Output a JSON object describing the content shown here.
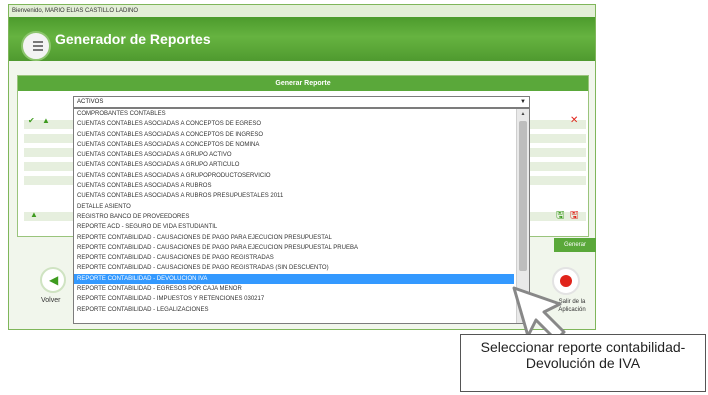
{
  "welcome_text": "Bienvenido, MARIO ELIAS CASTILLO LADINO",
  "header": {
    "title": "Generador de Reportes"
  },
  "panel": {
    "title": "Generar Reporte"
  },
  "select": {
    "selected_value": "ACTIVOS",
    "options": [
      "COMPROBANTES CONTABLES",
      "CUENTAS CONTABLES ASOCIADAS A CONCEPTOS DE EGRESO",
      "CUENTAS CONTABLES ASOCIADAS A CONCEPTOS DE INGRESO",
      "CUENTAS CONTABLES ASOCIADAS A CONCEPTOS DE NOMINA",
      "CUENTAS CONTABLES ASOCIADAS A GRUPO ACTIVO",
      "CUENTAS CONTABLES ASOCIADAS A GRUPO ARTICULO",
      "CUENTAS CONTABLES ASOCIADAS A GRUPOPRODUCTOSERVICIO",
      "CUENTAS CONTABLES ASOCIADAS A RUBROS",
      "CUENTAS CONTABLES ASOCIADAS A RUBROS PRESUPUESTALES 2011",
      "DETALLE ASIENTO",
      "REGISTRO BANCO DE PROVEEDORES",
      "REPORTE ACD - SEGURO DE VIDA ESTUDIANTIL",
      "REPORTE CONTABILIDAD - CAUSACIONES DE PAGO PARA EJECUCION PRESUPUESTAL",
      "REPORTE CONTABILIDAD - CAUSACIONES DE PAGO PARA EJECUCION PRESUPUESTAL PRUEBA",
      "REPORTE CONTABILIDAD - CAUSACIONES DE PAGO REGISTRADAS",
      "REPORTE CONTABILIDAD - CAUSACIONES DE PAGO REGISTRADAS (SIN DESCUENTO)",
      "REPORTE CONTABILIDAD - DEVOLUCION IVA",
      "REPORTE CONTABILIDAD - EGRESOS POR CAJA MENOR",
      "REPORTE CONTABILIDAD - IMPUESTOS Y RETENCIONES 030217",
      "REPORTE CONTABILIDAD - LEGALIZACIONES"
    ],
    "highlighted_option": "REPORTE CONTABILIDAD - DEVOLUCION IVA"
  },
  "buttons": {
    "generar": "Generar",
    "volver": "Volver",
    "salir_line1": "Salir de la",
    "salir_line2": "Aplicación"
  },
  "callout_text": "Seleccionar reporte contabilidad- Devolución de IVA",
  "colors": {
    "header_green": "#5aa83a",
    "selected_blue": "#3399ff",
    "close_red": "#e0241b"
  },
  "icons": [
    "check-icon",
    "up-arrow-icon",
    "close-x-icon",
    "save-icon",
    "back-arrow-icon",
    "exit-icon",
    "cursor-icon"
  ]
}
